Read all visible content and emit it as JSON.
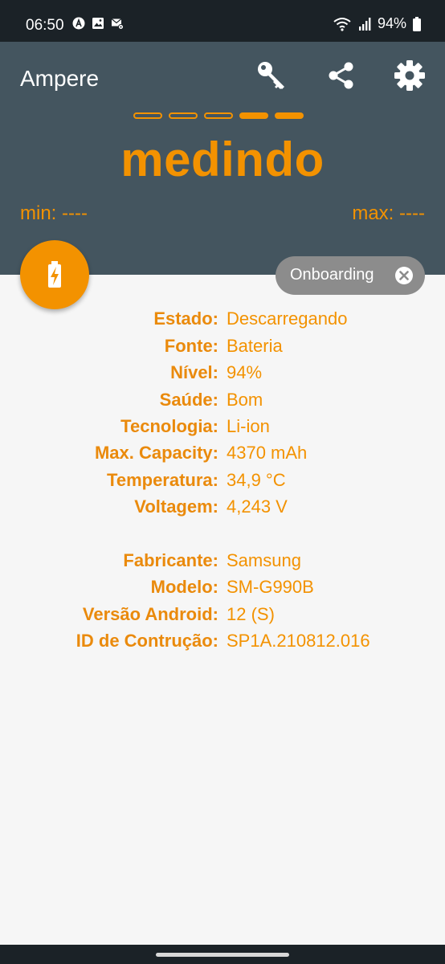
{
  "status_bar": {
    "time": "06:50",
    "battery": "94%",
    "left_icons": [
      "notification-a-icon",
      "image-icon",
      "mail-settings-icon"
    ],
    "right_icons": [
      "wifi-icon",
      "signal-icon",
      "battery-icon"
    ]
  },
  "app": {
    "title": "Ampere",
    "actions": [
      "key-icon",
      "share-icon",
      "gear-icon"
    ]
  },
  "meter": {
    "status": "medindo",
    "min_label": "min: ----",
    "max_label": "max: ----",
    "indicator_total": 5,
    "indicator_filled": 2
  },
  "chip": {
    "label": "Onboarding"
  },
  "battery_info": [
    {
      "label": "Estado:",
      "value": "Descarregando"
    },
    {
      "label": "Fonte:",
      "value": "Bateria"
    },
    {
      "label": "Nível:",
      "value": "94%"
    },
    {
      "label": "Saúde:",
      "value": "Bom"
    },
    {
      "label": "Tecnologia:",
      "value": "Li-ion"
    },
    {
      "label": "Max. Capacity:",
      "value": "4370 mAh"
    },
    {
      "label": "Temperatura:",
      "value": "34,9 °C"
    },
    {
      "label": "Voltagem:",
      "value": "4,243 V"
    }
  ],
  "device_info": [
    {
      "label": "Fabricante:",
      "value": "Samsung"
    },
    {
      "label": "Modelo:",
      "value": "SM-G990B"
    },
    {
      "label": "Versão Android:",
      "value": "12 (S)"
    },
    {
      "label": "ID de Contrução:",
      "value": "SP1A.210812.016"
    }
  ],
  "colors": {
    "accent": "#f39200",
    "header": "#44555f",
    "status_bar": "#1b2227",
    "background": "#f6f6f6",
    "chip": "#8c8c8c"
  }
}
